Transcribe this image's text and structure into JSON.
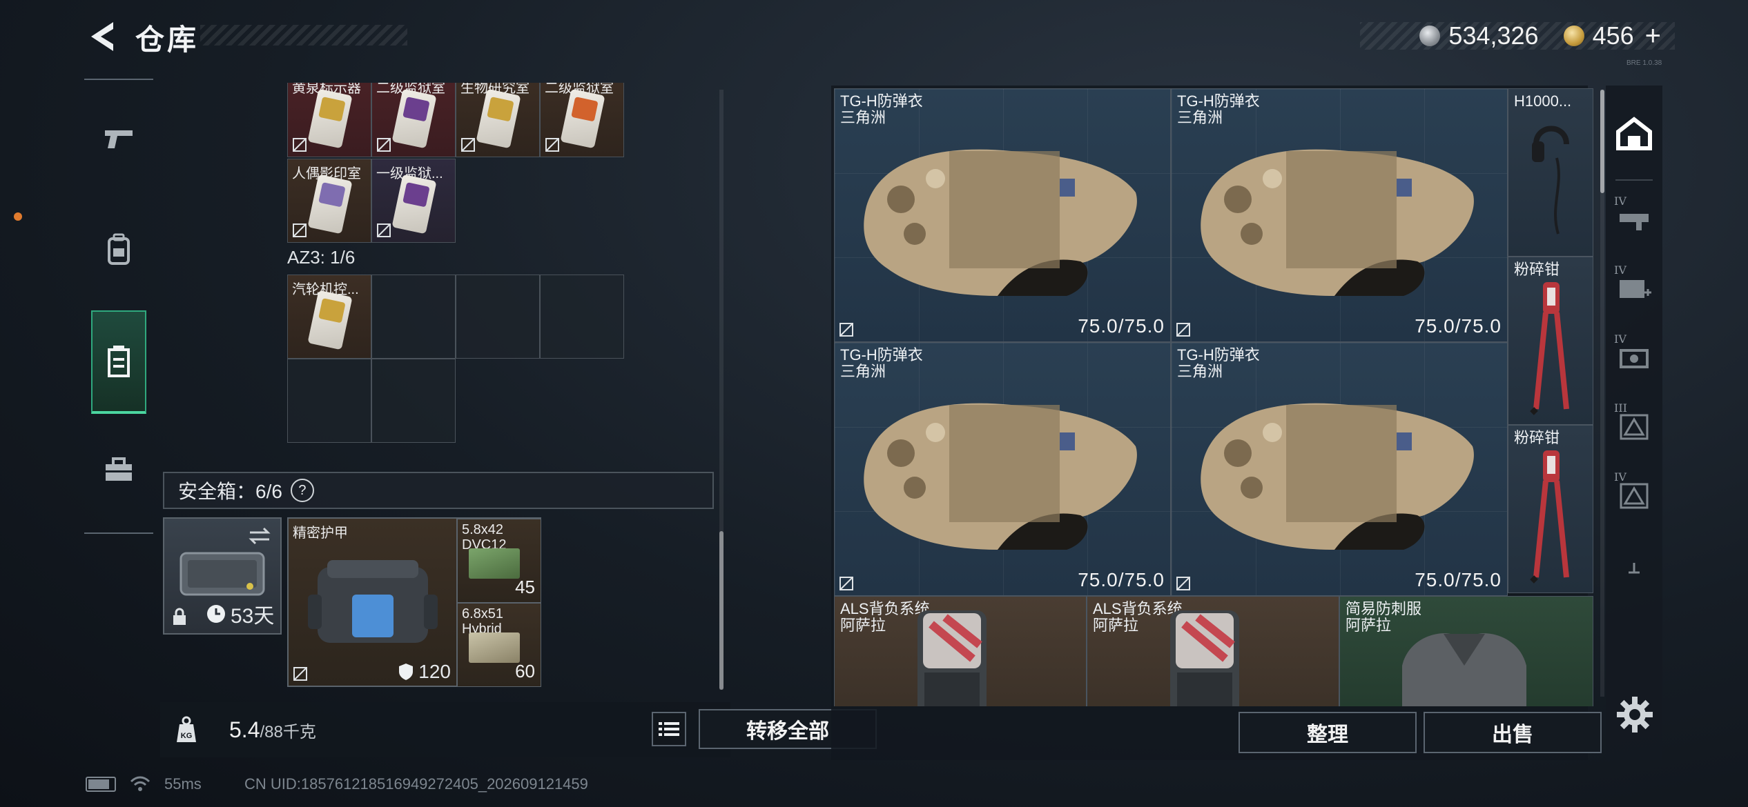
{
  "header": {
    "title": "仓库",
    "currency_silver": "534,326",
    "currency_gold": "456",
    "gold_plus": "+",
    "version": "BRE 1.0.38"
  },
  "left_nav": {
    "items": [
      {
        "name": "weapons",
        "icon": "pistol-icon",
        "active": false
      },
      {
        "name": "backpack",
        "icon": "backpack-icon",
        "active": false
      },
      {
        "name": "container",
        "icon": "container-icon",
        "active": true
      },
      {
        "name": "toolbox",
        "icon": "toolbox-icon",
        "active": false
      }
    ]
  },
  "keycards": {
    "row1": [
      {
        "label": "黄泉标示器"
      },
      {
        "label": "二级监狱室"
      },
      {
        "label": "生物研究室"
      },
      {
        "label": "二级监狱室"
      }
    ],
    "row2": [
      {
        "label": "人偶影印室"
      },
      {
        "label": "一级监狱..."
      }
    ],
    "az3_label": "AZ3: 1/6",
    "az3_item": "汽轮机控..."
  },
  "safe": {
    "label": "安全箱：6/6",
    "help": "?",
    "duration": "53天",
    "items": {
      "armor_label": "精密护甲",
      "armor_value": "120",
      "ammo1_name": "5.8x42 DVC12",
      "ammo1_qty": "45",
      "ammo2_name": "6.8x51 Hybrid",
      "ammo2_qty": "60"
    }
  },
  "bottom_left": {
    "weight_current": "5.4",
    "weight_max": "/88千克",
    "transfer_label": "转移全部"
  },
  "stash": {
    "armor_cells": [
      {
        "name": "TG-H防弹衣",
        "faction": "三角洲",
        "durability": "75.0/75.0"
      },
      {
        "name": "TG-H防弹衣",
        "faction": "三角洲",
        "durability": "75.0/75.0"
      },
      {
        "name": "TG-H防弹衣",
        "faction": "三角洲",
        "durability": "75.0/75.0"
      },
      {
        "name": "TG-H防弹衣",
        "faction": "三角洲",
        "durability": "75.0/75.0"
      }
    ],
    "narrow_items": [
      {
        "name": "H1000..."
      },
      {
        "name": "粉碎钳"
      },
      {
        "name": "粉碎钳"
      }
    ],
    "bottom_items": [
      {
        "name": "ALS背负系统",
        "faction": "阿萨拉"
      },
      {
        "name": "ALS背负系统",
        "faction": "阿萨拉"
      },
      {
        "name": "简易防刺服",
        "faction": "阿萨拉"
      }
    ],
    "sort_label": "整理",
    "sell_label": "出售"
  },
  "filter_col": {
    "tiers": [
      "IV",
      "IV",
      "IV",
      "III",
      "IV"
    ]
  },
  "footer": {
    "ping": "55ms",
    "uid": "CN UID:185761218516949272405_202609121459"
  },
  "colors": {
    "active_green": "#2fa97e",
    "accent_orange": "#e07b2e",
    "armor_bg": "#223446"
  }
}
